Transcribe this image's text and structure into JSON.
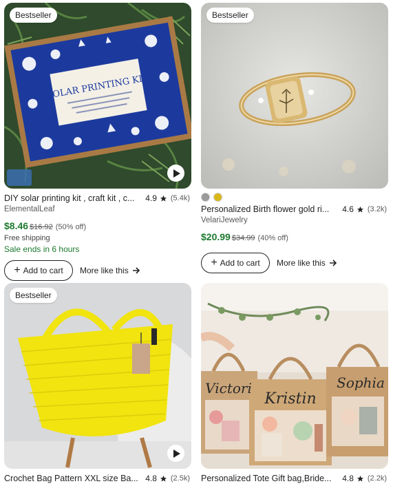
{
  "products": [
    {
      "badge": "Bestseller",
      "image": "solar printing kit",
      "kit_text": "SOLAR PRINTING KIT",
      "title": "DIY solar printing kit , craft kit , cyanotype kit",
      "display_title": "DIY solar printing kit , craft kit , c...",
      "rating": "4.9",
      "reviews": "(5.4k)",
      "shop": "ElementalLeaf",
      "price": "$8.46",
      "original_price": "$16.92",
      "discount": "(50% off)",
      "shipping": "Free shipping",
      "sale": "Sale ends in 6 hours",
      "add_to_cart": "Add to cart",
      "more_like_this": "More like this"
    },
    {
      "badge": "Bestseller",
      "image": "gold ring",
      "swatch_colors": [
        "#9a9a9a",
        "#d9b81a"
      ],
      "display_title": "Personalized Birth flower gold ri...",
      "rating": "4.6",
      "reviews": "(3.2k)",
      "shop": "VelariJewelry",
      "price": "$20.99",
      "original_price": "$34.99",
      "discount": "(40% off)",
      "add_to_cart": "Add to cart",
      "more_like_this": "More like this"
    },
    {
      "badge": "Bestseller",
      "image": "yellow crochet bag",
      "display_title": "Crochet Bag Pattern XXL size Ba...",
      "rating": "4.8",
      "reviews": "(2.5k)"
    },
    {
      "image": "tote gift bags",
      "bag_names": [
        "Victori",
        "Kristin",
        "Sophia"
      ],
      "display_title": "Personalized Tote Gift bag,Bride...",
      "rating": "4.8",
      "reviews": "(2.2k)"
    }
  ],
  "colors": {
    "sale_green": "#1d7a2e",
    "text": "#222222",
    "muted": "#595959"
  },
  "icons": [
    "star-icon",
    "play-icon",
    "plus-icon",
    "arrow-right-icon"
  ]
}
